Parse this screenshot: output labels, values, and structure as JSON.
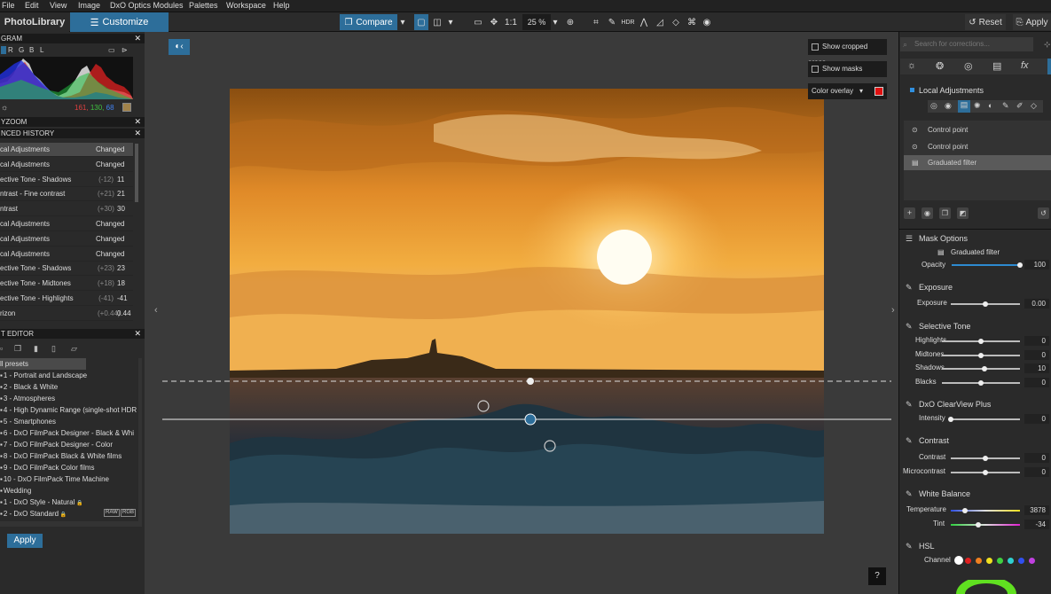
{
  "menu": [
    "File",
    "Edit",
    "View",
    "Image",
    "DxO Optics Modules",
    "Palettes",
    "Workspace",
    "Help"
  ],
  "tabs": {
    "photolibrary": "PhotoLibrary",
    "customize": "Customize"
  },
  "toolbar": {
    "compare": "Compare",
    "one_to_one": "1:1",
    "zoom": "25 %",
    "reset": "Reset",
    "apply": "Apply"
  },
  "histogram": {
    "title": "GRAM",
    "channels": [
      "R",
      "G",
      "B",
      "L"
    ],
    "rgb": [
      "161,",
      "130,",
      "68"
    ]
  },
  "loupe_title": "YZOOM",
  "history": {
    "title": "NCED HISTORY",
    "rows": [
      {
        "label": "cal Adjustments",
        "delta": "",
        "value": "Changed"
      },
      {
        "label": "cal Adjustments",
        "delta": "",
        "value": "Changed"
      },
      {
        "label": "ective Tone - Shadows",
        "delta": "(-12)",
        "value": "11"
      },
      {
        "label": "ntrast - Fine contrast",
        "delta": "(+21)",
        "value": "21"
      },
      {
        "label": "ntrast",
        "delta": "(+30)",
        "value": "30"
      },
      {
        "label": "cal Adjustments",
        "delta": "",
        "value": "Changed"
      },
      {
        "label": "cal Adjustments",
        "delta": "",
        "value": "Changed"
      },
      {
        "label": "cal Adjustments",
        "delta": "",
        "value": "Changed"
      },
      {
        "label": "ective Tone - Shadows",
        "delta": "(+23)",
        "value": "23"
      },
      {
        "label": "ective Tone - Midtones",
        "delta": "(+18)",
        "value": "18"
      },
      {
        "label": "ective Tone - Highlights",
        "delta": "(-41)",
        "value": "-41"
      },
      {
        "label": "rizon",
        "delta": "(+0.44)",
        "value": "0.44"
      }
    ]
  },
  "presets": {
    "title": "T EDITOR",
    "header": "ll presets",
    "items": [
      "1 - Portrait and Landscape",
      "2 - Black & White",
      "3 - Atmospheres",
      "4 - High Dynamic Range (single-shot HDR",
      "5 - Smartphones",
      "6 - DxO FilmPack Designer - Black & Whi",
      "7 - DxO FilmPack Designer - Color",
      "8 - DxO FilmPack Black & White films",
      "9 - DxO FilmPack Color films",
      "10 - DxO FilmPack Time Machine",
      "Wedding",
      "1 - DxO Style - Natural",
      "2 - DxO Standard"
    ],
    "badges": [
      "RAW",
      "RGB"
    ],
    "apply": "Apply"
  },
  "overlay": {
    "cropped": "Show cropped areas",
    "masks": "Show masks",
    "color": "Color overlay",
    "color_hex": "#e01010"
  },
  "help": "?",
  "search_placeholder": "Search for corrections...",
  "local": {
    "title": "Local Adjustments",
    "items": [
      "Control point",
      "Control point",
      "Graduated filter"
    ]
  },
  "mask": {
    "title": "Mask Options",
    "filter": "Graduated filter",
    "opacity_label": "Opacity",
    "opacity": "100",
    "opacity_pct": 1.0
  },
  "exposure": {
    "title": "Exposure",
    "label": "Exposure",
    "value": "0.00",
    "pos": 0.5
  },
  "tone": {
    "title": "Selective Tone",
    "rows": [
      {
        "label": "Highlights",
        "value": "0",
        "pos": 0.5
      },
      {
        "label": "Midtones",
        "value": "0",
        "pos": 0.5
      },
      {
        "label": "Shadows",
        "value": "10",
        "pos": 0.55
      },
      {
        "label": "Blacks",
        "value": "0",
        "pos": 0.5
      }
    ]
  },
  "clearview": {
    "title": "DxO ClearView Plus",
    "label": "Intensity",
    "value": "0",
    "pos": 0.0
  },
  "contrast": {
    "title": "Contrast",
    "rows": [
      {
        "label": "Contrast",
        "value": "0",
        "pos": 0.5
      },
      {
        "label": "Microcontrast",
        "value": "0",
        "pos": 0.5
      }
    ]
  },
  "wb": {
    "title": "White Balance",
    "rows": [
      {
        "label": "Temperature",
        "value": "3878",
        "pos": 0.2
      },
      {
        "label": "Tint",
        "value": "-34",
        "pos": 0.4
      }
    ]
  },
  "hsl": {
    "title": "HSL",
    "label": "Channel",
    "colors": [
      "#ffffff",
      "#e02020",
      "#f08020",
      "#f0e020",
      "#40d040",
      "#30d0d0",
      "#3050f0",
      "#c040e0"
    ]
  }
}
